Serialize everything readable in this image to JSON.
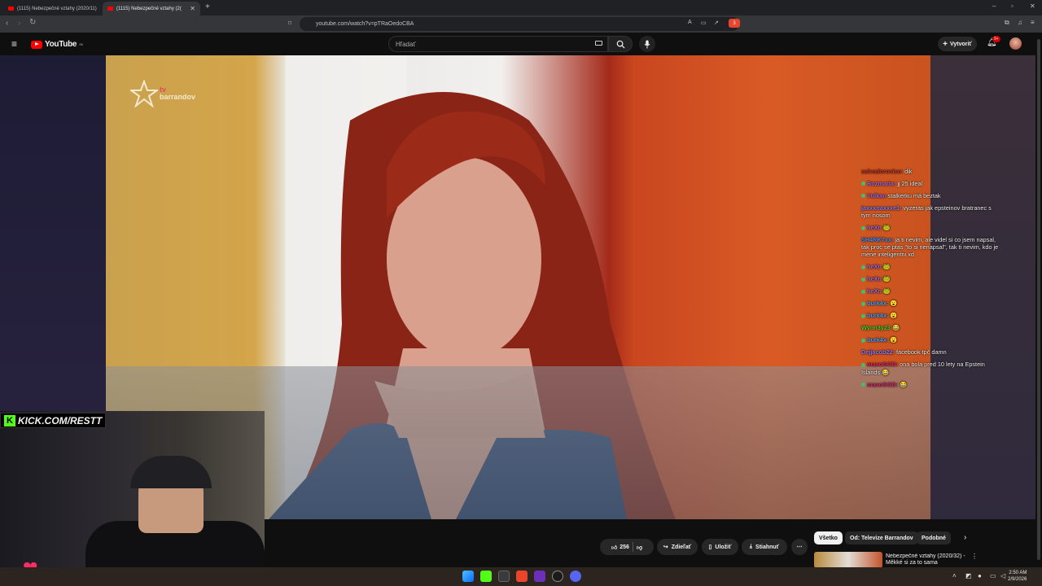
{
  "browser": {
    "tabs": [
      {
        "title": "(1115) Nebezpečné vztahy (2020/11)",
        "active": false
      },
      {
        "title": "(1115) Nebezpečné vztahy (2(",
        "active": true
      }
    ],
    "url": "youtube.com/watch?v=pTRaOedoCBA",
    "ext_badge": "3"
  },
  "youtube": {
    "logo": "YouTube",
    "region": "SK",
    "search_placeholder": "Hľadať",
    "create_label": "Vytvoriť",
    "notif_count": "9+"
  },
  "video": {
    "channel_brand_line1": "tv",
    "channel_brand_line2": "barrandov"
  },
  "chat": [
    {
      "user": "",
      "text": "",
      "color": "#d62d2d",
      "badge": false
    },
    {
      "user": "salvadorovice:",
      "text": "dik",
      "color": "#c0392b",
      "badge": false
    },
    {
      "user": "Rozmaria:",
      "text": "jj 25 ideal",
      "color": "#a86bd6",
      "badge": true
    },
    {
      "user": "Vulkan",
      "text": "stalkerku má beztak",
      "color": "#a86bd6",
      "badge": true
    },
    {
      "user": "jaxxxnaxxxe1:",
      "text": "vyzeras jak epsteinov bratranec s tym nosom",
      "color": "#8e7cf0",
      "badge": false
    },
    {
      "user": "heXn",
      "text": "🐸",
      "color": "#a86bd6",
      "badge": true
    },
    {
      "user": "SH4RK7xx:",
      "text": "ja ti nevim, ale videl si co jsem napsal, tak proc se ptas \"to si nenapsal\", tak ti nevim, kdo je mene inteligentni xd",
      "color": "#4a8ef2",
      "badge": false
    },
    {
      "user": "heXn",
      "text": "🐸",
      "color": "#a86bd6",
      "badge": true
    },
    {
      "user": "heXn",
      "text": "🐸",
      "color": "#a86bd6",
      "badge": true
    },
    {
      "user": "heXn",
      "text": "🐸",
      "color": "#a86bd6",
      "badge": true
    },
    {
      "user": "burk4x:",
      "text": "😮",
      "color": "#4aa3f2",
      "badge": true
    },
    {
      "user": "burk4x:",
      "text": "😮",
      "color": "#4aa3f2",
      "badge": true
    },
    {
      "user": "Wynn3y23",
      "text": "😂",
      "color": "#53d12b",
      "badge": false
    },
    {
      "user": "burk4x:",
      "text": "😮",
      "color": "#4aa3f2",
      "badge": true
    },
    {
      "user": "Dejjacob22:",
      "text": "facebook tpč damn",
      "color": "#8e7cf0",
      "badge": false
    },
    {
      "user": "maxoGOD:",
      "text": "ona bola pred 10 lety na Epstein Islands 😂",
      "color": "#d62d6a",
      "badge": true
    },
    {
      "user": "maxoGOD:",
      "text": "😂",
      "color": "#d62d6a",
      "badge": true
    }
  ],
  "webcam": {
    "kick_label": "KICK.COM/RESTT"
  },
  "actions": {
    "like_count": "256",
    "share_label": "Zdieľať",
    "save_label": "Uložiť",
    "download_label": "Stiahnuť"
  },
  "related": {
    "chips": [
      "Všetko",
      "Od: Televize Barrandov",
      "Podobné"
    ],
    "first_title": "Nebezpečné vztahy (2020/32) - Měkké si za to sama"
  },
  "taskbar": {
    "time": "2:50 AM",
    "date": "2/9/2026"
  },
  "colors": {
    "youtube_red": "#ff0000",
    "kick_green": "#53fc18"
  }
}
